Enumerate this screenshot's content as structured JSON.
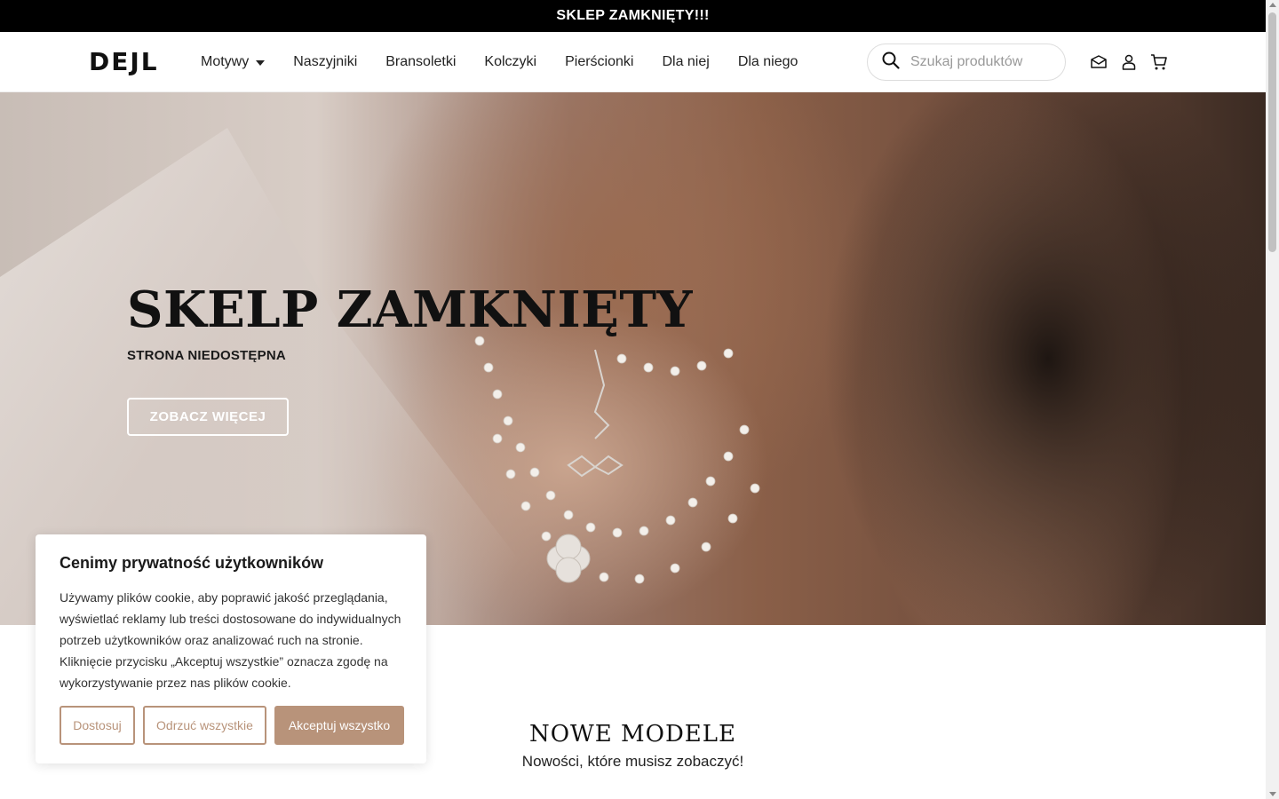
{
  "announcement": {
    "text": "SKLEP ZAMKNIĘTY!!!"
  },
  "header": {
    "logo": "DEJL",
    "nav": [
      {
        "label": "Motywy",
        "has_dropdown": true
      },
      {
        "label": "Naszyjniki"
      },
      {
        "label": "Bransoletki"
      },
      {
        "label": "Kolczyki"
      },
      {
        "label": "Pierścionki"
      },
      {
        "label": "Dla niej"
      },
      {
        "label": "Dla niego"
      }
    ],
    "search": {
      "placeholder": "Szukaj produktów",
      "value": ""
    },
    "icons": [
      "mail-icon",
      "user-icon",
      "cart-icon"
    ]
  },
  "hero": {
    "title": "SKELP ZAMKNIĘTY",
    "subtitle": "STRONA NIEDOSTĘPNA",
    "button": "ZOBACZ WIĘCEJ"
  },
  "section": {
    "title": "NOWE MODELE",
    "subtitle": "Nowości, które musisz zobaczyć!"
  },
  "cookie_banner": {
    "title": "Cenimy prywatność użytkowników",
    "text": "Używamy plików cookie, aby poprawić jakość przeglądania, wyświetlać reklamy lub treści dostosowane do indywidualnych potrzeb użytkowników oraz analizować ruch na stronie. Kliknięcie przycisku „Akceptuj wszystkie” oznacza zgodę na wykorzystywanie przez nas plików cookie.",
    "buttons": {
      "customize": "Dostosuj",
      "reject": "Odrzuć wszystkie",
      "accept": "Akceptuj wszystko"
    }
  },
  "colors": {
    "accent": "#b8937a",
    "topbar": "#000000"
  }
}
